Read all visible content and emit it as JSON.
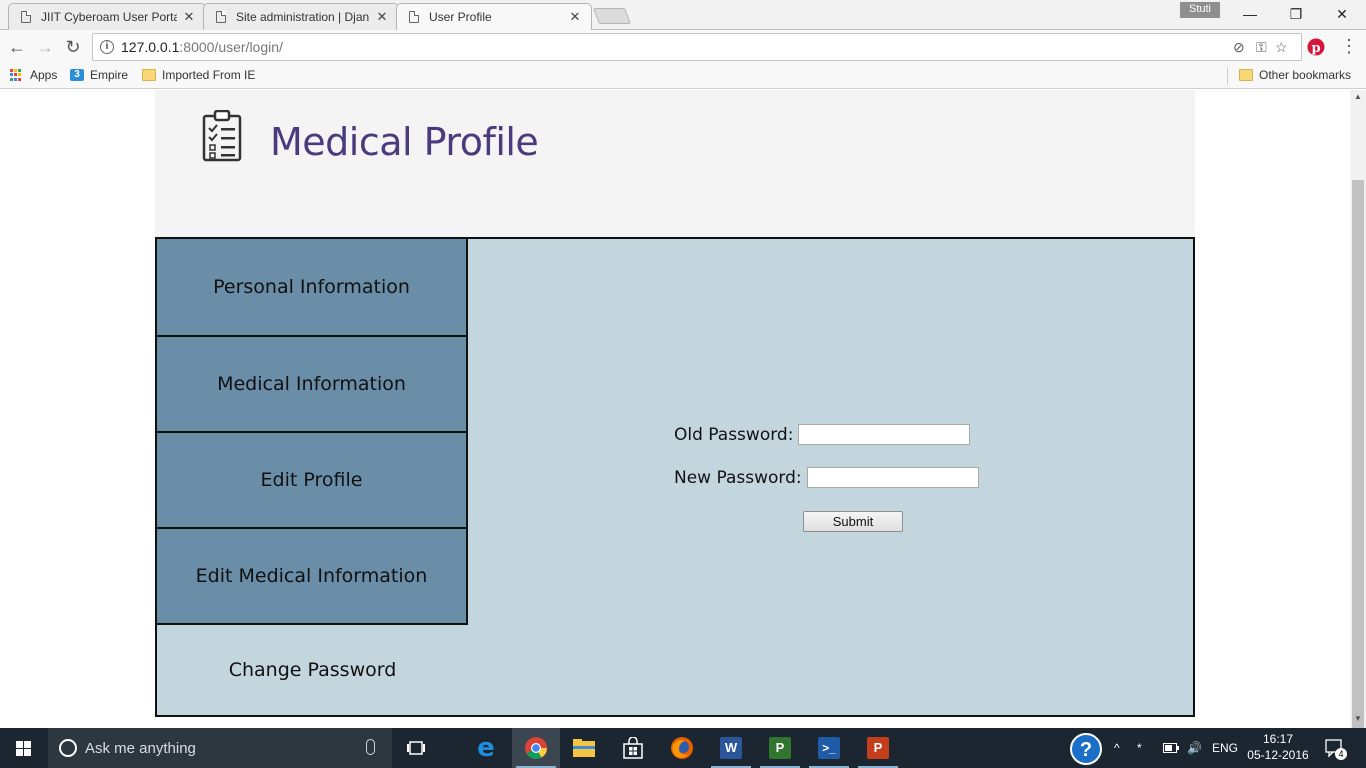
{
  "browser": {
    "tabs": [
      {
        "title": "JIIT Cyberoam User Porta",
        "active": false
      },
      {
        "title": "Site administration | Djan",
        "active": false
      },
      {
        "title": "User Profile",
        "active": true
      }
    ],
    "profile_name": "Stuti",
    "address": {
      "host": "127.0.0.1",
      "path": ":8000/user/login/"
    },
    "bookmarks": [
      {
        "label": "Apps",
        "icon": "apps-grid-icon"
      },
      {
        "label": "Empire",
        "icon": "empire-icon"
      },
      {
        "label": "Imported From IE",
        "icon": "folder-icon"
      }
    ],
    "other_bookmarks": "Other bookmarks"
  },
  "page": {
    "title": "Medical Profile",
    "header_icon": "clipboard-checklist-icon",
    "colors": {
      "title": "#4a3b7e",
      "sidebar": "#6a8ea8",
      "panel": "#c3d6dd"
    },
    "sidebar": [
      {
        "label": "Personal Information",
        "active": false
      },
      {
        "label": "Medical Information",
        "active": false
      },
      {
        "label": "Edit Profile",
        "active": false
      },
      {
        "label": "Edit Medical Information",
        "active": false
      },
      {
        "label": "Change Password",
        "active": true
      }
    ],
    "form": {
      "old_password_label": "Old Password:",
      "old_password_value": "",
      "new_password_label": "New Password:",
      "new_password_value": "",
      "submit_label": "Submit"
    }
  },
  "taskbar": {
    "search_placeholder": "Ask me anything",
    "apps": [
      "task-view-icon",
      "edge-icon",
      "chrome-icon",
      "file-explorer-icon",
      "store-icon",
      "firefox-icon",
      "word-icon",
      "project-icon",
      "powershell-icon",
      "powerpoint-icon"
    ],
    "language": "ENG",
    "time": "16:17",
    "date": "05-12-2016",
    "notification_count": "4"
  }
}
